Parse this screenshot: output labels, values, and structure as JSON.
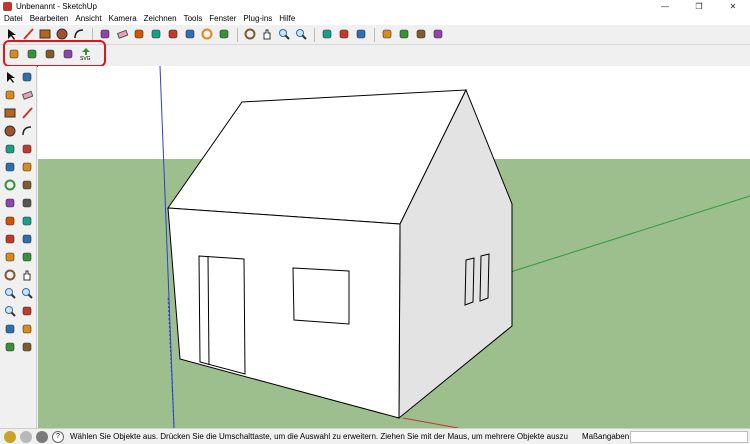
{
  "window": {
    "title": "Unbenannt - SketchUp",
    "minimize": "—",
    "maximize": "❐",
    "close": "✕"
  },
  "menu": [
    "Datei",
    "Bearbeiten",
    "Ansicht",
    "Kamera",
    "Zeichnen",
    "Tools",
    "Fenster",
    "Plug-ins",
    "Hilfe"
  ],
  "toolbar_main": [
    "select-icon",
    "line-icon",
    "rectangle-icon",
    "circle-icon",
    "arc-icon",
    "make-component-icon",
    "eraser-icon",
    "tape-measure-icon",
    "paint-bucket-icon",
    "push-pull-icon",
    "move-icon",
    "rotate-icon",
    "offset-icon",
    "orbit-icon",
    "pan-icon",
    "zoom-icon",
    "zoom-extents-icon",
    "add-location-icon",
    "toggle-terrain-icon",
    "preview-in-google-earth-icon",
    "get-models-icon",
    "share-model-icon",
    "share-component-icon",
    "extension-warehouse-icon"
  ],
  "toolbar_plugin": {
    "items": [
      "plugin-tool-1-icon",
      "plugin-tool-2-icon",
      "plugin-tool-3-icon",
      "plugin-tool-4-icon",
      "svg-export-icon"
    ],
    "svg_label": "SVG"
  },
  "left_toolbar": [
    [
      "select-icon",
      "make-component-icon"
    ],
    [
      "paint-bucket-icon",
      "eraser-icon"
    ],
    [
      "rectangle-icon",
      "line-icon"
    ],
    [
      "circle-icon",
      "arc-icon"
    ],
    [
      "polygon-icon",
      "freehand-icon"
    ],
    [
      "move-icon",
      "push-pull-icon"
    ],
    [
      "rotate-icon",
      "follow-me-icon"
    ],
    [
      "scale-icon",
      "offset-icon"
    ],
    [
      "tape-measure-icon",
      "dimension-icon"
    ],
    [
      "protractor-icon",
      "text-icon"
    ],
    [
      "axes-icon",
      "3d-text-icon"
    ],
    [
      "orbit-icon",
      "pan-icon"
    ],
    [
      "zoom-icon",
      "zoom-window-icon"
    ],
    [
      "zoom-extents-icon",
      "previous-view-icon"
    ],
    [
      "position-camera-icon",
      "look-around-icon"
    ],
    [
      "walk-icon",
      "section-plane-icon"
    ]
  ],
  "colors": {
    "sky": "#ffffff",
    "ground": "#9dbe8d",
    "red_axis": "#c0392b",
    "green_axis": "#2e9e3a",
    "blue_axis": "#2f3fcf",
    "highlight": "#e0151b"
  },
  "status": {
    "text": "Wählen Sie Objekte aus. Drücken Sie die Umschalttaste, um die Auswahl zu erweitern. Ziehen Sie mit der Maus, um mehrere Objekte auszu",
    "measure_label": "Maßangaben",
    "measure_value": ""
  }
}
